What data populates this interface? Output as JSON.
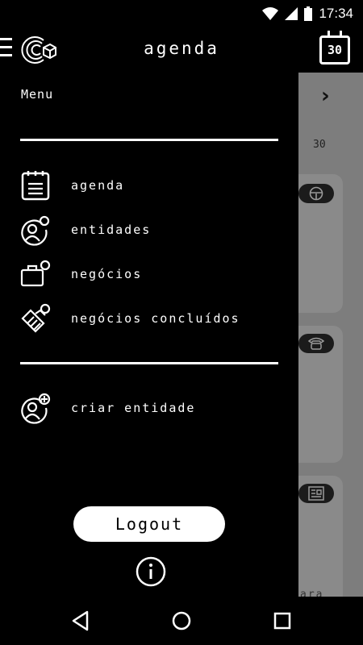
{
  "status_bar": {
    "time": "17:34",
    "icons": [
      "wifi-icon",
      "signal-icon",
      "battery-icon"
    ]
  },
  "header": {
    "title": "agenda",
    "calendar_day": "30"
  },
  "background": {
    "day_label": "30",
    "card_text": "ara",
    "pill_icons": [
      "steering-wheel-icon",
      "phone-icon",
      "newspaper-icon"
    ]
  },
  "drawer": {
    "menu_heading": "Menu",
    "items": [
      {
        "label": "agenda",
        "icon": "notepad-icon"
      },
      {
        "label": "entidades",
        "icon": "person-icon"
      },
      {
        "label": "negócios",
        "icon": "briefcase-icon"
      },
      {
        "label": "negócios concluídos",
        "icon": "handshake-icon"
      }
    ],
    "secondary_items": [
      {
        "label": "criar entidade",
        "icon": "add-person-icon"
      }
    ],
    "logout_label": "Logout"
  },
  "colors": {
    "drawer_bg": "#000000",
    "text": "#ffffff",
    "scrim": "#7d7d7d"
  }
}
